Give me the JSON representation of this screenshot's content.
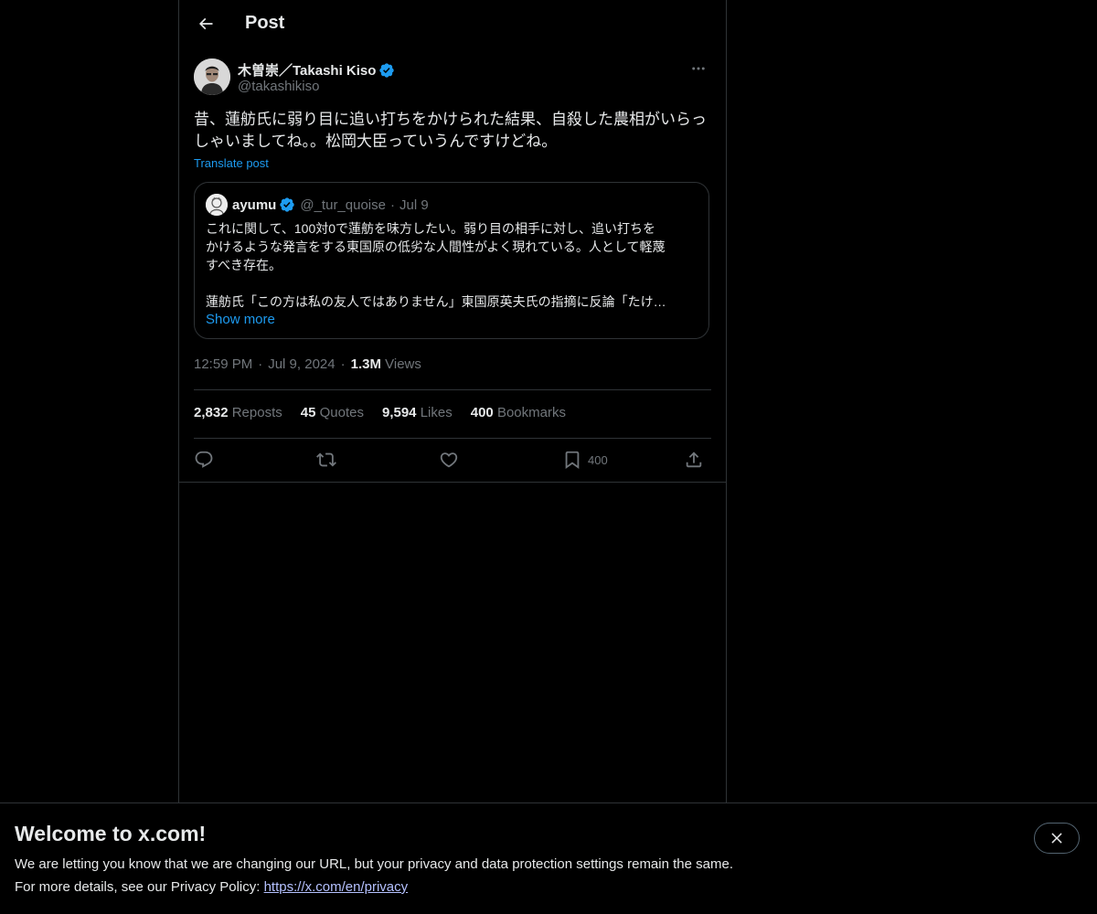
{
  "header": {
    "title": "Post",
    "back_icon": "arrow-left-icon"
  },
  "post": {
    "author_name": "木曽崇／Takashi Kiso",
    "author_handle": "@takashikiso",
    "verified": true,
    "text_line1": "昔、蓮舫氏に弱り目に追い打ちをかけられた結果、自殺した農相がいらっ",
    "text_line2": "しゃいましてね。。松岡大臣っていうんですけどね。",
    "translate_label": "Translate post",
    "time": "12:59 PM",
    "date": "Jul 9, 2024",
    "views_count": "1.3M",
    "views_label": "Views"
  },
  "quote": {
    "author_name": "ayumu",
    "author_handle": "@_tur_quoise",
    "date": "Jul 9",
    "line1": "これに関して、100対0で蓮舫を味方したい。弱り目の相手に対し、追い打ちを",
    "line2": "かけるような発言をする東国原の低劣な人間性がよく現れている。人として軽蔑",
    "line3": "すべき存在。",
    "line4": "蓮舫氏「この方は私の友人ではありません」東国原英夫氏の指摘に反論「たけ…",
    "show_more": "Show more"
  },
  "stats": {
    "reposts_count": "2,832",
    "reposts_label": "Reposts",
    "quotes_count": "45",
    "quotes_label": "Quotes",
    "likes_count": "9,594",
    "likes_label": "Likes",
    "bookmarks_count": "400",
    "bookmarks_label": "Bookmarks"
  },
  "actions": {
    "bookmark_count": "400"
  },
  "banner": {
    "title": "Welcome to x.com!",
    "line1": "We are letting you know that we are changing our URL, but your privacy and data protection settings remain the same.",
    "line2_prefix": "For more details, see our Privacy Policy: ",
    "link": "https://x.com/en/privacy"
  },
  "colors": {
    "accent": "#1d9bf0",
    "muted": "#71767b",
    "border": "#2f3336",
    "background": "#000000"
  }
}
